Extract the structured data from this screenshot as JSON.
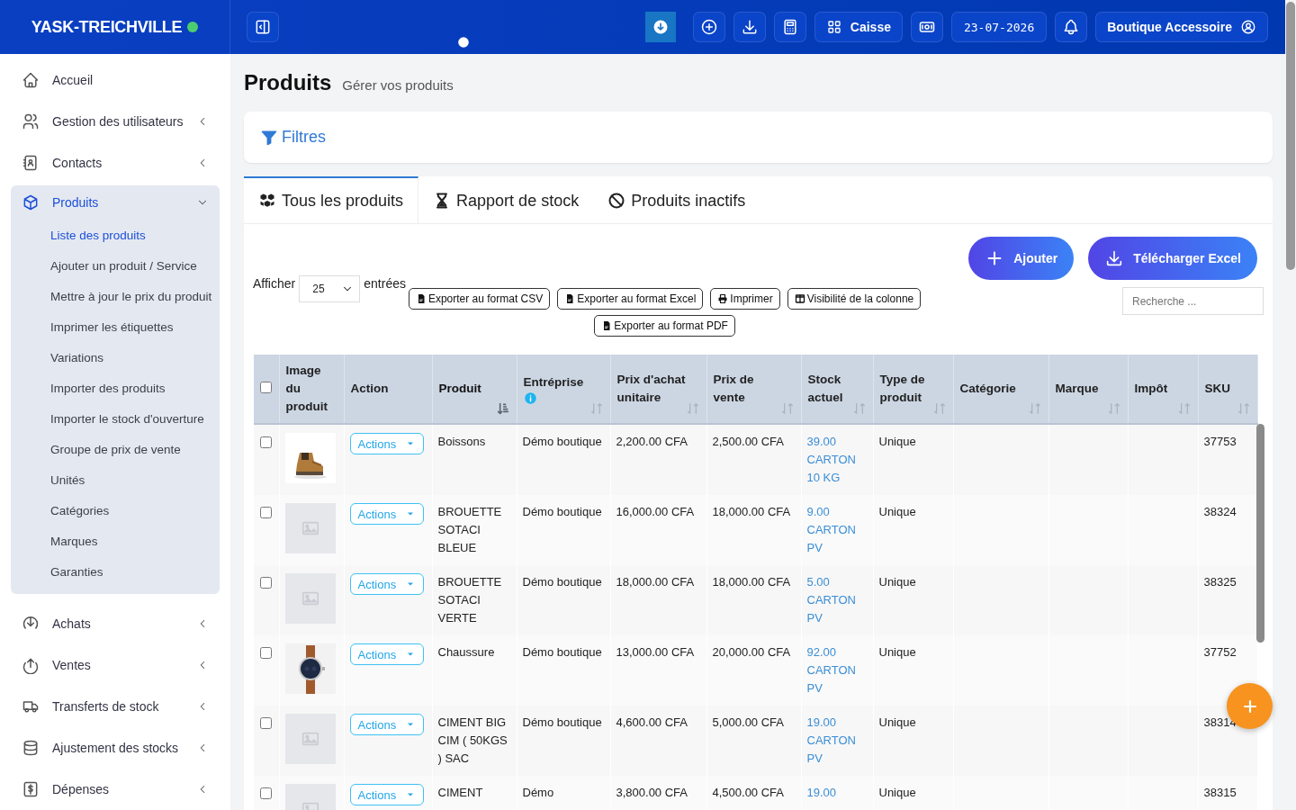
{
  "header": {
    "brand": "YASK-TREICHVILLE",
    "online": true,
    "caisse": "Caisse",
    "date": "23-07-2026",
    "user": "Boutique Accessoire"
  },
  "sidebar": {
    "items": [
      {
        "label": "Accueil",
        "has_children": false,
        "selected": false
      },
      {
        "label": "Gestion des utilisateurs",
        "has_children": true,
        "expanded": false,
        "selected": false
      },
      {
        "label": "Contacts",
        "has_children": true,
        "expanded": false,
        "selected": false
      },
      {
        "label": "Produits",
        "has_children": true,
        "expanded": true,
        "selected": true,
        "children": [
          {
            "label": "Liste des produits",
            "selected": true
          },
          {
            "label": "Ajouter un produit / Service",
            "selected": false
          },
          {
            "label": "Mettre à jour le prix du produit",
            "selected": false
          },
          {
            "label": "Imprimer les étiquettes",
            "selected": false
          },
          {
            "label": "Variations",
            "selected": false
          },
          {
            "label": "Importer des produits",
            "selected": false
          },
          {
            "label": "Importer le stock d'ouverture",
            "selected": false
          },
          {
            "label": "Groupe de prix de vente",
            "selected": false
          },
          {
            "label": "Unités",
            "selected": false
          },
          {
            "label": "Catégories",
            "selected": false
          },
          {
            "label": "Marques",
            "selected": false
          },
          {
            "label": "Garanties",
            "selected": false
          }
        ]
      },
      {
        "label": "Achats",
        "has_children": true,
        "expanded": false,
        "selected": false
      },
      {
        "label": "Ventes",
        "has_children": true,
        "expanded": false,
        "selected": false
      },
      {
        "label": "Transferts de stock",
        "has_children": true,
        "expanded": false,
        "selected": false
      },
      {
        "label": "Ajustement des stocks",
        "has_children": true,
        "expanded": false,
        "selected": false
      },
      {
        "label": "Dépenses",
        "has_children": true,
        "expanded": false,
        "selected": false
      }
    ]
  },
  "page": {
    "title": "Produits",
    "subtitle": "Gérer vos produits"
  },
  "filters": {
    "label": "Filtres"
  },
  "tabs": [
    {
      "label": "Tous les produits",
      "selected": true
    },
    {
      "label": "Rapport de stock",
      "selected": false
    },
    {
      "label": "Produits inactifs",
      "selected": false
    }
  ],
  "actions": [
    "Ajouter",
    "Télécharger Excel"
  ],
  "length": {
    "prefix": "Afficher",
    "value": "25",
    "suffix": "entrées"
  },
  "exports": [
    "Exporter au format CSV",
    "Exporter au format Excel",
    "Imprimer",
    "Visibilité de la colonne",
    "Exporter au format PDF"
  ],
  "search": {
    "placeholder": "Recherche ..."
  },
  "table": {
    "all_checked": false,
    "columns": [
      {
        "label": "Image du produit",
        "sortable": false,
        "sorted": false
      },
      {
        "label": "Action",
        "sortable": false,
        "sorted": false
      },
      {
        "label": "Produit",
        "sortable": true,
        "sorted": true
      },
      {
        "label": "Entréprise",
        "sortable": true,
        "sorted": false,
        "info": true
      },
      {
        "label": "Prix d'achat unitaire",
        "sortable": true,
        "sorted": false
      },
      {
        "label": "Prix de vente",
        "sortable": true,
        "sorted": false
      },
      {
        "label": "Stock actuel",
        "sortable": true,
        "sorted": false
      },
      {
        "label": "Type de produit",
        "sortable": true,
        "sorted": false
      },
      {
        "label": "Catégorie",
        "sortable": true,
        "sorted": false
      },
      {
        "label": "Marque",
        "sortable": true,
        "sorted": false
      },
      {
        "label": "Impôt",
        "sortable": true,
        "sorted": false
      },
      {
        "label": "SKU",
        "sortable": true,
        "sorted": false
      }
    ],
    "rows": [
      {
        "checked": false,
        "kind": "picture",
        "action": "Actions",
        "product": "Boissons",
        "company": "Démo boutique",
        "purchase": "2,200.00 CFA",
        "sale": "2,500.00 CFA",
        "stock": "39.00",
        "unit": "CARTON 10 KG",
        "type": "Unique",
        "sku": "37753"
      },
      {
        "checked": false,
        "kind": "placeholder",
        "action": "Actions",
        "product": "BROUETTE SOTACI BLEUE",
        "company": "Démo boutique",
        "purchase": "16,000.00 CFA",
        "sale": "18,000.00 CFA",
        "stock": "9.00",
        "unit": "CARTON PV",
        "type": "Unique",
        "sku": "38324"
      },
      {
        "checked": false,
        "kind": "placeholder",
        "action": "Actions",
        "product": "BROUETTE SOTACI VERTE",
        "company": "Démo boutique",
        "purchase": "18,000.00 CFA",
        "sale": "18,000.00 CFA",
        "stock": "5.00",
        "unit": "CARTON PV",
        "type": "Unique",
        "sku": "38325"
      },
      {
        "checked": false,
        "kind": "picture",
        "action": "Actions",
        "product": "Chaussure",
        "company": "Démo boutique",
        "purchase": "13,000.00 CFA",
        "sale": "20,000.00 CFA",
        "stock": "92.00",
        "unit": "CARTON PV",
        "type": "Unique",
        "sku": "37752"
      },
      {
        "checked": false,
        "kind": "placeholder",
        "action": "Actions",
        "product": "CIMENT BIG CIM ( 50KGS ) SAC",
        "company": "Démo boutique",
        "purchase": "4,600.00 CFA",
        "sale": "5,000.00 CFA",
        "stock": "19.00",
        "unit": "CARTON PV",
        "type": "Unique",
        "sku": "38314"
      },
      {
        "checked": false,
        "kind": "placeholder",
        "action": "Actions",
        "product": "CIMENT",
        "company": "Démo",
        "purchase": "3,800.00 CFA",
        "sale": "4,500.00 CFA",
        "stock": "19.00",
        "type": "Unique",
        "sku": "38315"
      }
    ]
  }
}
